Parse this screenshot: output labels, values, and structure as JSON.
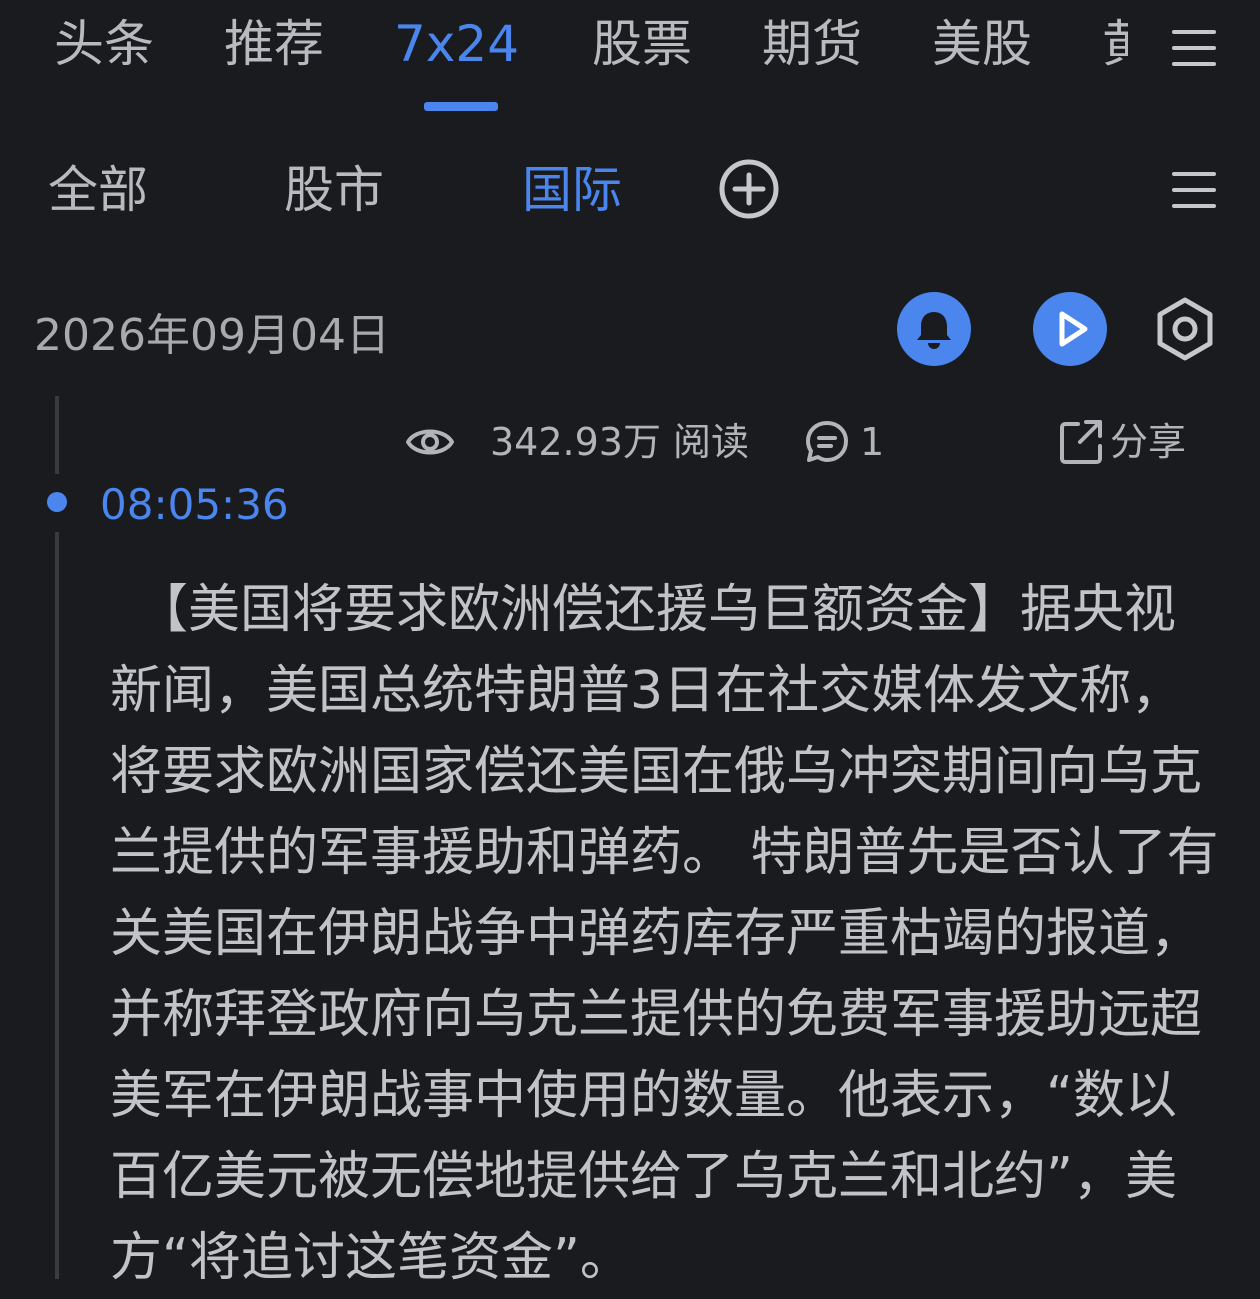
{
  "top_tabs": [
    {
      "label": "头条",
      "active": false
    },
    {
      "label": "推荐",
      "active": false
    },
    {
      "label": "7x24",
      "active": true
    },
    {
      "label": "股票",
      "active": false
    },
    {
      "label": "期货",
      "active": false
    },
    {
      "label": "美股",
      "active": false
    },
    {
      "label": "黄",
      "active": false
    }
  ],
  "sub_tabs": [
    {
      "label": "全部",
      "active": false
    },
    {
      "label": "股市",
      "active": false
    },
    {
      "label": "国际",
      "active": true
    }
  ],
  "date": "2026年09月04日",
  "news": {
    "views": "342.93万 阅读",
    "comments": "1",
    "share_label": "分享",
    "time": "08:05:36",
    "body": "【美国将要求欧洲偿还援乌巨额资金】据央视新闻，美国总统特朗普3日在社交媒体发文称，将要求欧洲国家偿还美国在俄乌冲突期间向乌克兰提供的军事援助和弹药。 特朗普先是否认了有关美国在伊朗战争中弹药库存严重枯竭的报道，并称拜登政府向乌克兰提供的免费军事援助远超美军在伊朗战事中使用的数量。他表示，“数以百亿美元被无偿地提供给了乌克兰和北约”，美方“将追讨这笔资金”。"
  },
  "icons": {
    "menu": "menu-icon",
    "add": "add-circle-icon",
    "bell": "bell-icon",
    "play": "play-icon",
    "settings": "hexagon-settings-icon",
    "eye": "eye-icon",
    "comment": "comment-icon",
    "share": "share-icon"
  },
  "colors": {
    "background": "#1a1b1f",
    "accent": "#4a86ee",
    "text": "#c2c3c8",
    "muted": "#a9aab0"
  }
}
